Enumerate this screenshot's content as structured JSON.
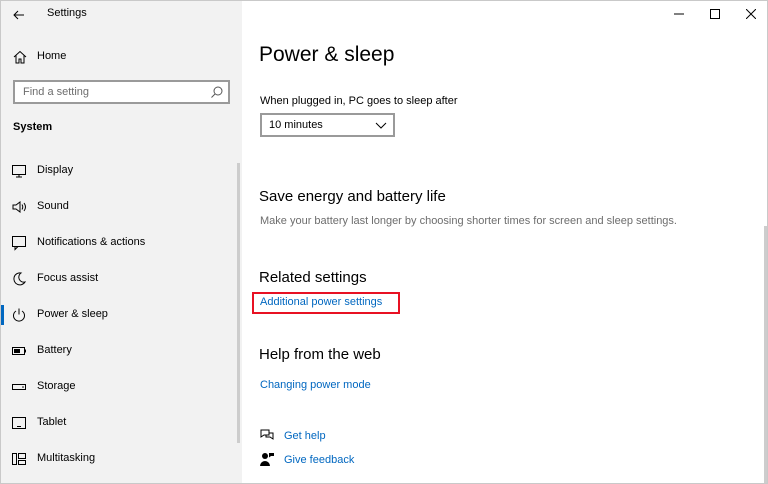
{
  "window": {
    "app_title": "Settings",
    "controls": [
      "minimize",
      "maximize",
      "close"
    ]
  },
  "sidebar": {
    "home_label": "Home",
    "search_placeholder": "Find a setting",
    "section_heading": "System",
    "items": [
      {
        "label": "Display",
        "icon": "display-icon"
      },
      {
        "label": "Sound",
        "icon": "sound-icon"
      },
      {
        "label": "Notifications & actions",
        "icon": "notifications-icon"
      },
      {
        "label": "Focus assist",
        "icon": "focus-assist-icon"
      },
      {
        "label": "Power & sleep",
        "icon": "power-icon",
        "active": true
      },
      {
        "label": "Battery",
        "icon": "battery-icon"
      },
      {
        "label": "Storage",
        "icon": "storage-icon"
      },
      {
        "label": "Tablet",
        "icon": "tablet-icon"
      },
      {
        "label": "Multitasking",
        "icon": "multitasking-icon"
      }
    ]
  },
  "main": {
    "title": "Power & sleep",
    "sleep_label": "When plugged in, PC goes to sleep after",
    "sleep_value": "10 minutes",
    "save_heading": "Save energy and battery life",
    "save_desc": "Make your battery last longer by choosing shorter times for screen and sleep settings.",
    "related_heading": "Related settings",
    "related_link": "Additional power settings",
    "help_heading": "Help from the web",
    "help_link": "Changing power mode",
    "get_help": "Get help",
    "give_feedback": "Give feedback"
  },
  "colors": {
    "accent": "#0067c0",
    "highlight_box": "#e81123",
    "sidebar_bg": "#f2f2f2"
  }
}
